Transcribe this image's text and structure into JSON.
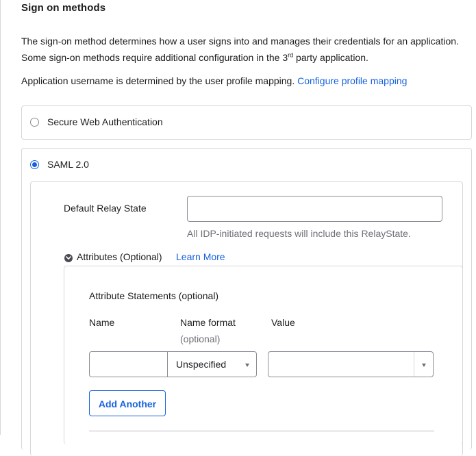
{
  "section": {
    "title": "Sign on methods"
  },
  "description": {
    "text_before": "The sign-on method determines how a user signs into and manages their credentials for an application. Some sign-on methods require additional configuration in the 3",
    "superscript": "rd",
    "text_after": " party application."
  },
  "username_mapping": {
    "text": "Application username is determined by the user profile mapping.",
    "link_label": "Configure profile mapping"
  },
  "methods": {
    "swa": {
      "label": "Secure Web Authentication",
      "selected": false
    },
    "saml": {
      "label": "SAML 2.0",
      "selected": true
    }
  },
  "relay_state": {
    "label": "Default Relay State",
    "value": "",
    "hint": "All IDP-initiated requests will include this RelayState."
  },
  "attributes": {
    "toggle_label": "Attributes (Optional)",
    "learn_more": "Learn More",
    "statements_title": "Attribute Statements (optional)",
    "columns": {
      "name": "Name",
      "name_format": "Name format",
      "name_format_sub": "(optional)",
      "value": "Value"
    },
    "row": {
      "name_value": "",
      "format_selected": "Unspecified",
      "value_selected": ""
    },
    "add_button": "Add Another"
  },
  "colors": {
    "link": "#1662dd",
    "border": "#d7d7dc",
    "text": "#1d1d21",
    "muted": "#6e6e78"
  },
  "icons": {
    "toggle": "chevron-down-circle-icon",
    "caret": "caret-down-icon"
  }
}
